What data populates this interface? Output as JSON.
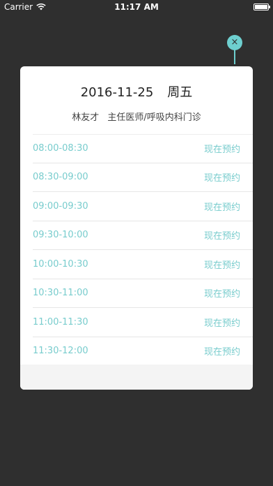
{
  "status_bar": {
    "carrier": "Carrier",
    "time": "11:17 AM",
    "battery_level": 1.0
  },
  "modal": {
    "date": "2016-11-25",
    "weekday": "周五",
    "doctor_name": "林友才",
    "doctor_title_dept": "主任医师/呼吸内科门诊",
    "close_symbol": "×",
    "slots": [
      {
        "time": "08:00-08:30",
        "action": "现在预约"
      },
      {
        "time": "08:30-09:00",
        "action": "现在预约"
      },
      {
        "time": "09:00-09:30",
        "action": "现在预约"
      },
      {
        "time": "09:30-10:00",
        "action": "现在预约"
      },
      {
        "time": "10:00-10:30",
        "action": "现在预约"
      },
      {
        "time": "10:30-11:00",
        "action": "现在预约"
      },
      {
        "time": "11:00-11:30",
        "action": "现在预约"
      },
      {
        "time": "11:30-12:00",
        "action": "现在预约"
      }
    ]
  },
  "colors": {
    "accent": "#6ecfcf",
    "background": "#2f2f2f",
    "slot_text": "#78cccd"
  }
}
